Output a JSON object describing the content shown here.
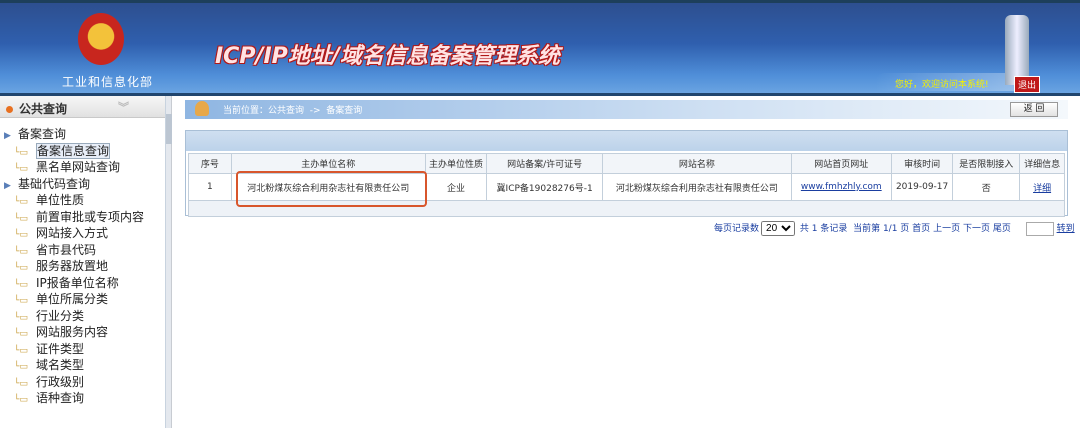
{
  "header": {
    "ministry": "工业和信息化部",
    "title": "ICP/IP地址/域名信息备案管理系统",
    "welcome": "您好，欢迎访问本系统!",
    "logout": "退出"
  },
  "sidebar": {
    "title": "公共查询",
    "items": [
      {
        "label": "备案查询",
        "level": "root"
      },
      {
        "label": "备案信息查询",
        "level": "child",
        "selected": true
      },
      {
        "label": "黑名单网站查询",
        "level": "child"
      },
      {
        "label": "基础代码查询",
        "level": "root"
      },
      {
        "label": "单位性质",
        "level": "child"
      },
      {
        "label": "前置审批或专项内容",
        "level": "child"
      },
      {
        "label": "网站接入方式",
        "level": "child"
      },
      {
        "label": "省市县代码",
        "level": "child"
      },
      {
        "label": "服务器放置地",
        "level": "child"
      },
      {
        "label": "IP报备单位名称",
        "level": "child"
      },
      {
        "label": "单位所属分类",
        "level": "child"
      },
      {
        "label": "行业分类",
        "level": "child"
      },
      {
        "label": "网站服务内容",
        "level": "child"
      },
      {
        "label": "证件类型",
        "level": "child"
      },
      {
        "label": "域名类型",
        "level": "child"
      },
      {
        "label": "行政级别",
        "level": "child"
      },
      {
        "label": "语种查询",
        "level": "child"
      }
    ]
  },
  "breadcrumb": {
    "text": "当前位置：公共查询  ->  备案查询",
    "back": "返 回"
  },
  "table": {
    "headers": [
      "序号",
      "主办单位名称",
      "主办单位性质",
      "网站备案/许可证号",
      "网站名称",
      "网站首页网址",
      "审核时间",
      "是否限制接入",
      "详细信息"
    ],
    "rows": [
      [
        "1",
        "河北粉煤灰综合利用杂志社有限责任公司",
        "企业",
        "冀ICP备19028276号-1",
        "河北粉煤灰综合利用杂志社有限责任公司",
        "www.fmhzhly.com",
        "2019-09-17",
        "否",
        "详细"
      ]
    ]
  },
  "pager": {
    "per_page_label": "每页记录数",
    "per_page": "20",
    "total": "共 1 条记录",
    "current": "当前第 1/1 页",
    "first": "首页",
    "prev": "上一页",
    "next": "下一页",
    "last": "尾页",
    "go": "转到"
  }
}
